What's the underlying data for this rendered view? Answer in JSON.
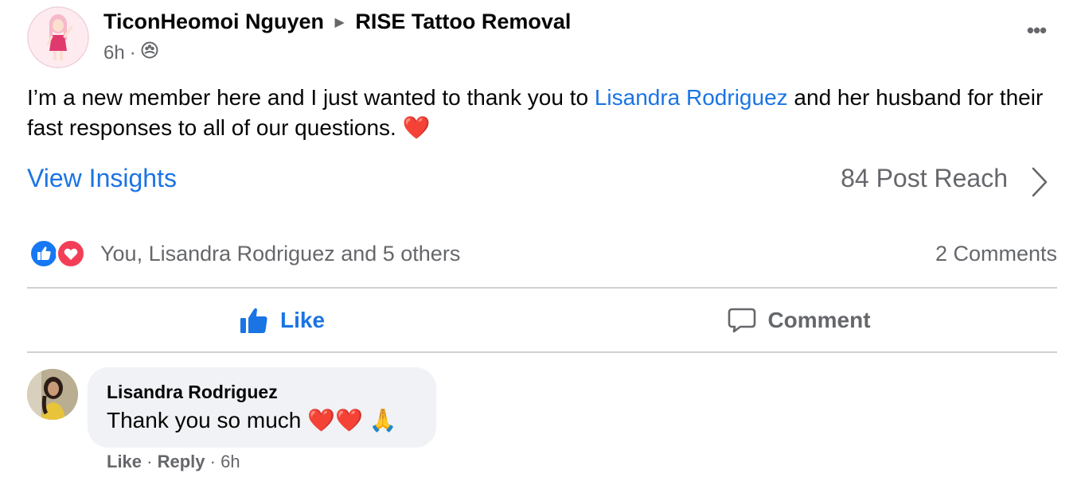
{
  "post": {
    "author": "TiconHeomoi Nguyen",
    "group": "RISE Tattoo Removal",
    "time": "6h",
    "privacy_separator": "·",
    "more_label": "•••",
    "text_before_mention": "I’m a new member here and I just wanted to thank you to ",
    "mention": "Lisandra Rodriguez",
    "text_after_mention": " and her husband for their fast responses to all of our questions. ",
    "text_emoji": "❤️"
  },
  "insights": {
    "view_label": "View Insights",
    "reach_label": "84 Post Reach"
  },
  "reactions": {
    "names": "You, Lisandra Rodriguez and 5 others",
    "comments_count": "2 Comments"
  },
  "actions": {
    "like_label": "Like",
    "comment_label": "Comment"
  },
  "comment": {
    "author": "Lisandra Rodriguez",
    "text": "Thank you so much ❤️❤️ 🙏",
    "like_label": "Like",
    "reply_label": "Reply",
    "time": "6h",
    "separator": " · "
  },
  "icons": {
    "privacy": "group-privacy-icon",
    "chevron": "chevron-right-icon",
    "like": "thumbs-up-icon",
    "comment": "comment-bubble-icon",
    "react_like": "like-reaction-icon",
    "react_love": "love-reaction-icon"
  },
  "colors": {
    "link_blue": "#1b74e4",
    "secondary_text": "#65676b",
    "like_reaction": "#1877f2",
    "love_reaction": "#f33e58",
    "bubble_bg": "#f0f2f5",
    "divider": "#ced0d4"
  }
}
